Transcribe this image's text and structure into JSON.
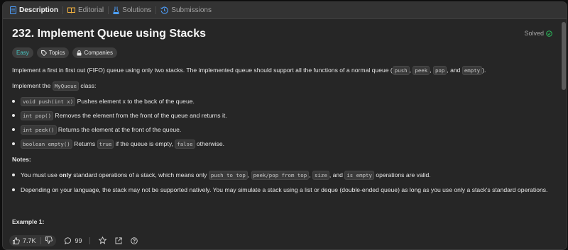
{
  "tabs": [
    {
      "label": "Description",
      "icon": "description-icon",
      "active": true,
      "color": "#4ea0ff"
    },
    {
      "label": "Editorial",
      "icon": "editorial-icon",
      "active": false,
      "color": "#f5b340"
    },
    {
      "label": "Solutions",
      "icon": "flask-icon",
      "active": false,
      "color": "#4ea0ff"
    },
    {
      "label": "Submissions",
      "icon": "history-icon",
      "active": false,
      "color": "#4ea0ff"
    }
  ],
  "problem": {
    "title": "232. Implement Queue using Stacks",
    "solved_label": "Solved",
    "solved_color": "#2cbb5d",
    "tags": {
      "easy": "Easy",
      "topics": "Topics",
      "companies": "Companies"
    }
  },
  "description": {
    "intro": {
      "t1": "Implement a first in first out (FIFO) queue using only two stacks. The implemented queue should support all the functions of a normal queue (",
      "c1": "push",
      "s1": ", ",
      "c2": "peek",
      "s2": ", ",
      "c3": "pop",
      "s3": ", and ",
      "c4": "empty",
      "t2": ")."
    },
    "implement": {
      "t1": "Implement the ",
      "code": "MyQueue",
      "t2": " class:"
    },
    "methods": [
      {
        "code": "void push(int x)",
        "text": " Pushes element x to the back of the queue."
      },
      {
        "code": "int pop()",
        "text": " Removes the element from the front of the queue and returns it."
      },
      {
        "code": "int peek()",
        "text": " Returns the element at the front of the queue."
      },
      {
        "code": "boolean empty()",
        "t1": " Returns ",
        "c1": "true",
        "t2": " if the queue is empty, ",
        "c2": "false",
        "t3": " otherwise."
      }
    ],
    "notes_heading": "Notes:",
    "notes": [
      {
        "t1": "You must use ",
        "b1": "only",
        "t2": " standard operations of a stack, which means only ",
        "c1": "push to top",
        "s1": ", ",
        "c2": "peek/pop from top",
        "s2": ", ",
        "c3": "size",
        "s3": ", and ",
        "c4": "is empty",
        "t3": " operations are valid."
      },
      {
        "text": "Depending on your language, the stack may not be supported natively. You may simulate a stack using a list or deque (double-ended queue) as long as you use only a stack's standard operations."
      }
    ],
    "example_heading": "Example 1:"
  },
  "footer": {
    "likes": "7.7K",
    "comments": "99"
  }
}
